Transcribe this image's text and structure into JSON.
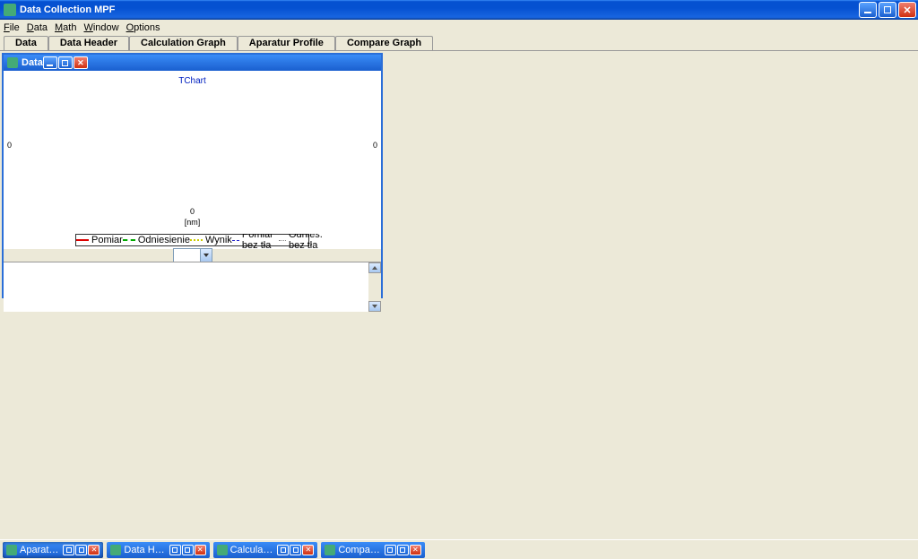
{
  "window": {
    "title": "Data Collection MPF"
  },
  "menu": {
    "file": "File",
    "data": "Data",
    "math": "Math",
    "window": "Window",
    "options": "Options"
  },
  "tabs": {
    "t1": "Data",
    "t2": "Data Header",
    "t3": "Calculation Graph",
    "t4": "Aparatur Profile",
    "t5": "Compare Graph"
  },
  "child": {
    "title": "Data"
  },
  "chart_data": {
    "type": "line",
    "title": "TChart",
    "xlabel": "[nm]",
    "ylabel": "",
    "xlim": [
      0,
      0
    ],
    "ylim_left": [
      0,
      0
    ],
    "ylim_right": [
      0,
      0
    ],
    "categories": [],
    "series": [
      {
        "name": "Pomiar",
        "values": [],
        "style": "solid",
        "color": "#d00000"
      },
      {
        "name": "Odniesienie",
        "values": [],
        "style": "dash",
        "color": "#00a000"
      },
      {
        "name": "Wynik",
        "values": [],
        "style": "dot",
        "color": "#cccc00"
      },
      {
        "name": "Pomiar bez tła",
        "values": [],
        "style": "dashdot",
        "color": "#2020c0"
      },
      {
        "name": "Odnies. bez tła",
        "values": [],
        "style": "dot",
        "color": "#888888"
      }
    ],
    "ticks": {
      "left0": "0",
      "right0": "0",
      "x0": "0"
    }
  },
  "taskbar": {
    "b1": "Aparat…",
    "b2": "Data H…",
    "b3": "Calcula…",
    "b4": "Compa…"
  }
}
